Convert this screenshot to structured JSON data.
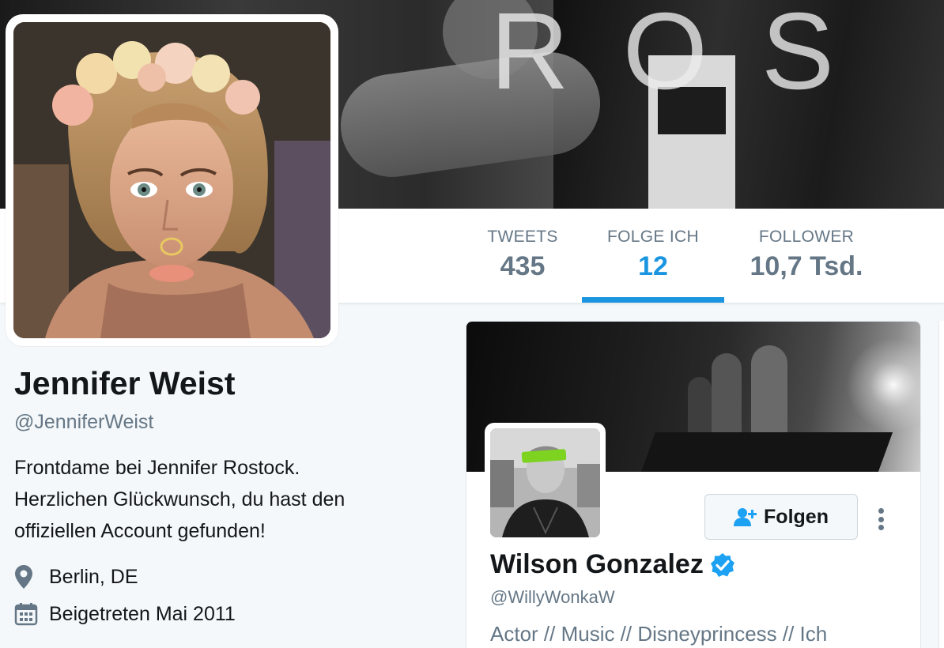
{
  "banner": {
    "text": "ROS"
  },
  "nav": {
    "tweets": {
      "label": "TWEETS",
      "value": "435"
    },
    "following": {
      "label": "FOLGE ICH",
      "value": "12"
    },
    "followers": {
      "label": "FOLLOWER",
      "value": "10,7 Tsd."
    },
    "active": "following",
    "accent_color": "#1b95e0"
  },
  "profile": {
    "name": "Jennifer Weist",
    "handle": "@JenniferWeist",
    "bio": "Frontdame bei Jennifer Rostock.\nHerzlichen Glückwunsch, du hast den\noffiziellen Account gefunden!",
    "location": "Berlin, DE",
    "joined": "Beigetreten Mai 2011",
    "location_icon": "location-pin-icon",
    "joined_icon": "calendar-icon"
  },
  "suggestion_card": {
    "name": "Wilson Gonzalez",
    "handle": "@WillyWonkaW",
    "bio": "Actor // Music // Disneyprincess // Ich",
    "verified": true,
    "follow_label": "Folgen",
    "follow_icon": "add-user-icon",
    "more_icon": "more-vertical-icon"
  },
  "colors": {
    "background": "#f5f8fa",
    "text_primary": "#14171a",
    "text_secondary": "#657786",
    "verified": "#1da1f2"
  }
}
